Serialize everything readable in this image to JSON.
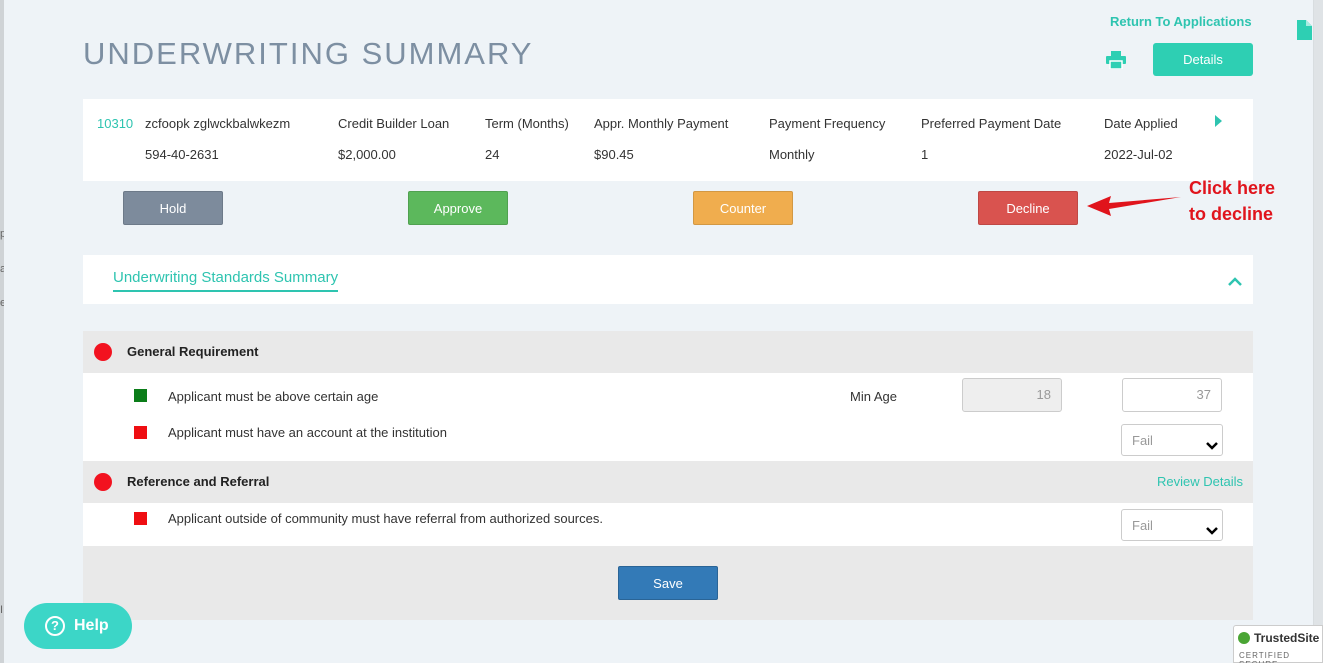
{
  "header": {
    "title": "UNDERWRITING SUMMARY",
    "return_link": "Return To Applications",
    "details_label": "Details"
  },
  "application": {
    "id": "10310",
    "applicant_name": "zcfoopk zglwckbalwkezm",
    "ssn": "594-40-2631",
    "columns": [
      {
        "label": "Credit Builder Loan",
        "value": "$2,000.00"
      },
      {
        "label": "Term (Months)",
        "value": "24"
      },
      {
        "label": "Appr. Monthly Payment",
        "value": "$90.45"
      },
      {
        "label": "Payment Frequency",
        "value": "Monthly"
      },
      {
        "label": "Preferred Payment Date",
        "value": "1"
      },
      {
        "label": "Date Applied",
        "value": "2022-Jul-02"
      }
    ]
  },
  "actions": {
    "hold": "Hold",
    "approve": "Approve",
    "counter": "Counter",
    "decline": "Decline"
  },
  "annotation": {
    "line1": "Click here",
    "line2": "to decline",
    "color": "#e0141c"
  },
  "standards": {
    "title": "Underwriting Standards Summary"
  },
  "groups": [
    {
      "title": "General Requirement",
      "status_color": "#f2121f",
      "rows": [
        {
          "text": "Applicant must be above certain age",
          "status": "green",
          "field_label": "Min Age",
          "required_value": "18",
          "actual_value": "37"
        },
        {
          "text": "Applicant must have an account at the institution",
          "status": "red",
          "select_value": "Fail"
        }
      ]
    },
    {
      "title": "Reference and Referral",
      "status_color": "#f2121f",
      "review_link": "Review Details",
      "rows": [
        {
          "text": "Applicant outside of community must have referral from authorized sources.",
          "status": "red",
          "select_value": "Fail"
        }
      ]
    }
  ],
  "save_label": "Save",
  "help": {
    "label": "Help",
    "icon": "question-circle-icon"
  },
  "trusted_site": {
    "name": "TrustedSite",
    "sub": "CERTIFIED SECURE"
  },
  "colors": {
    "accent": "#2ec4b0",
    "hold": "#7d8b9c",
    "approve": "#5cb85c",
    "counter": "#f0ad4e",
    "decline": "#d9534f",
    "save": "#337ab7"
  },
  "sliver": {
    "line1": "p",
    "line2": "a",
    "line3": "e",
    "line4": "I"
  }
}
